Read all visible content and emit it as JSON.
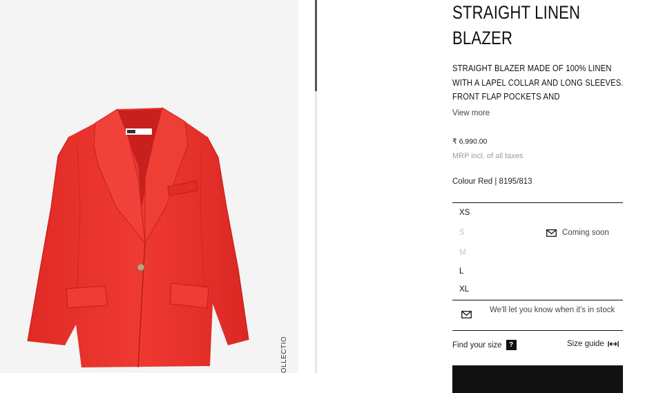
{
  "product": {
    "title": "STRAIGHT LINEN BLAZER",
    "description": "STRAIGHT BLAZER MADE OF 100% LINEN WITH A LAPEL COLLAR AND LONG SLEEVES. FRONT FLAP POCKETS AND",
    "view_more": "View more",
    "price": "₹ 6,990.00",
    "tax_note": "MRP incl. of all taxes",
    "colour": "Colour Red | 8195/813",
    "image_alt_color": "#e8332e",
    "collection_label": "COLLECTION"
  },
  "sizes": [
    {
      "label": "XS",
      "available": true
    },
    {
      "label": "S",
      "available": false
    },
    {
      "label": "M",
      "available": false
    },
    {
      "label": "L",
      "available": true
    },
    {
      "label": "XL",
      "available": true
    }
  ],
  "coming_soon": {
    "label": "Coming soon",
    "icon": "envelope-icon"
  },
  "notify": {
    "text": "We'll let you know when it's in stock",
    "icon": "envelope-icon"
  },
  "find_size": {
    "label": "Find your size",
    "help": "?"
  },
  "size_guide": {
    "label": "Size guide",
    "icon": "resize-arrows-icon"
  },
  "add_button": {
    "label": ""
  },
  "colors": {
    "accent": "#111111",
    "disabled": "#c4c4c4",
    "muted": "#9a9a9a"
  }
}
